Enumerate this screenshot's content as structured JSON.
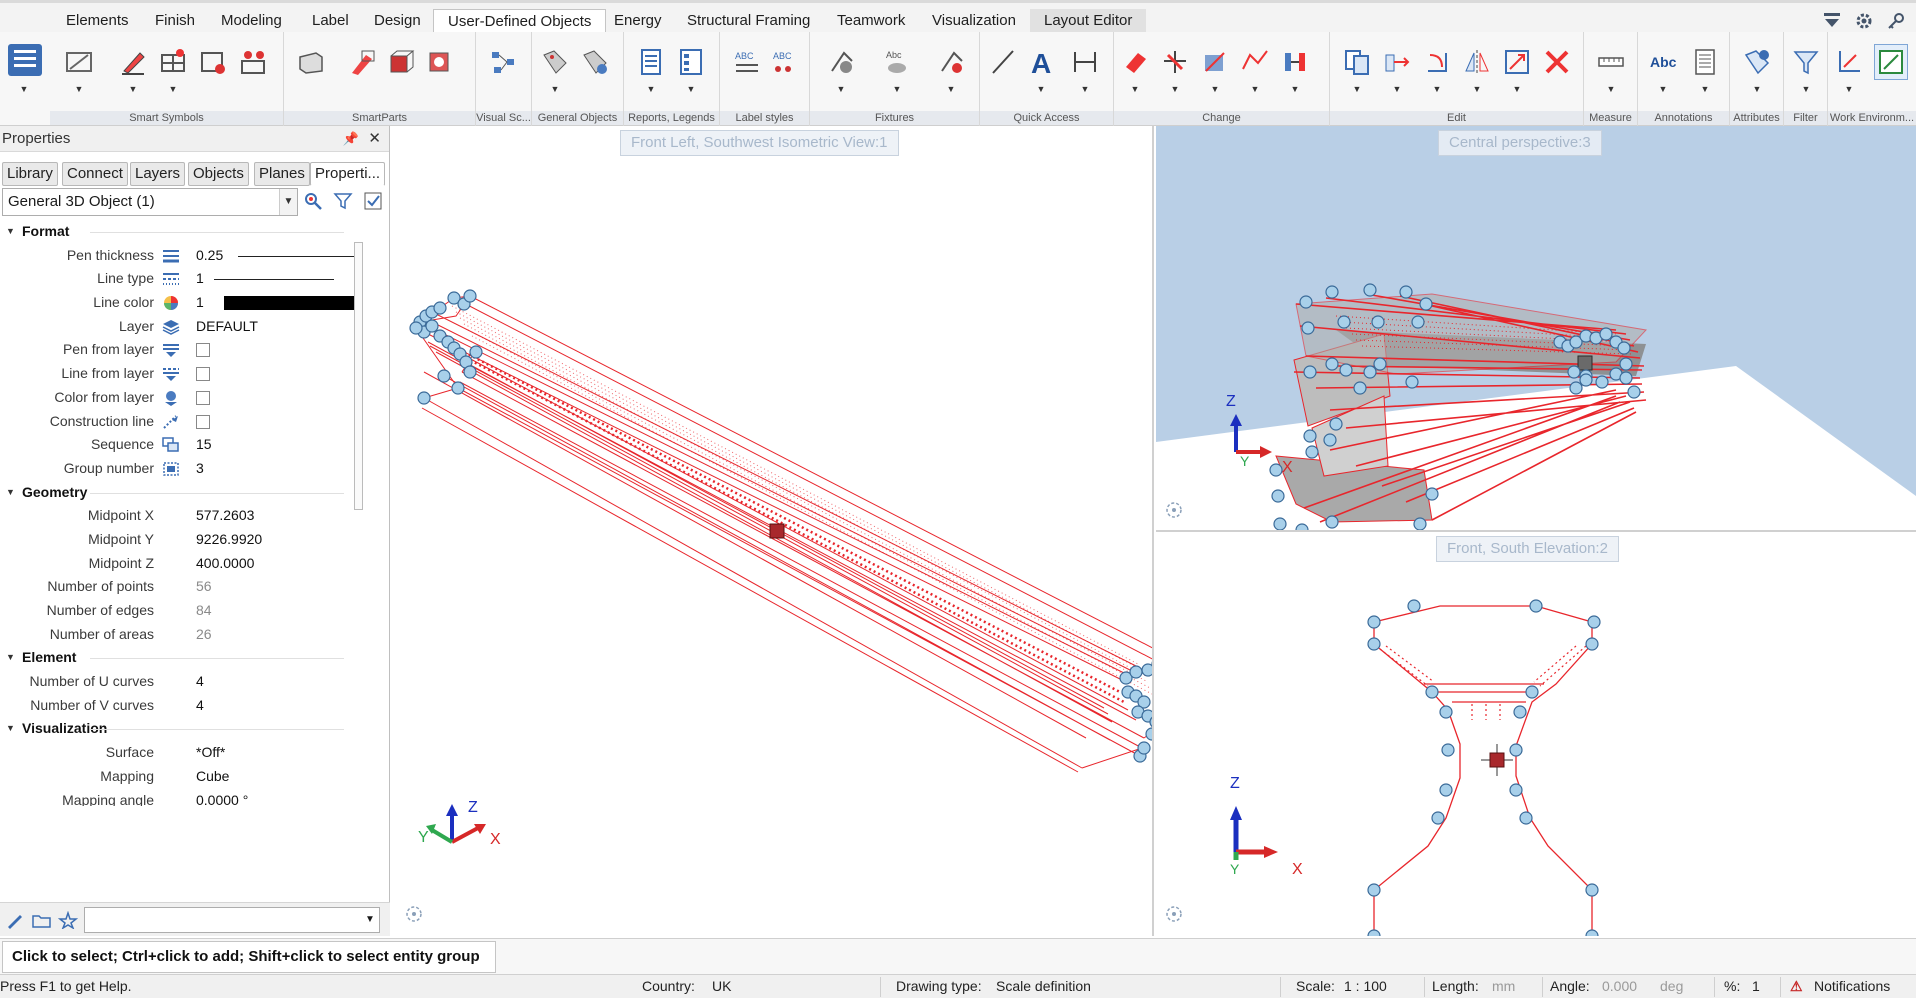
{
  "menu_tabs": [
    "Elements",
    "Finish",
    "Modeling",
    "Label",
    "Design",
    "User-Defined Objects",
    "Energy",
    "Structural Framing",
    "Teamwork",
    "Visualization",
    "Layout Editor"
  ],
  "active_tab": "User-Defined Objects",
  "ribbon_groups": [
    "Smart Symbols",
    "SmartParts",
    "Visual Sc...",
    "General Objects",
    "Reports, Legends",
    "Label styles",
    "Fixtures",
    "Quick Access",
    "Change",
    "Edit",
    "Measure",
    "Annotations",
    "Attributes",
    "Filter",
    "Work Environm..."
  ],
  "properties": {
    "title": "Properties",
    "tabs": [
      "Library",
      "Connect",
      "Layers",
      "Objects",
      "Planes",
      "Properti..."
    ],
    "object_selector": "General 3D Object (1)",
    "sections": {
      "format": "Format",
      "geometry": "Geometry",
      "element": "Element",
      "visualization": "Visualization"
    },
    "format": {
      "pen_thickness_label": "Pen thickness",
      "pen_thickness": "0.25",
      "line_type_label": "Line type",
      "line_type": "1",
      "line_color_label": "Line color",
      "line_color": "1",
      "layer_label": "Layer",
      "layer": "DEFAULT",
      "pen_from_layer_label": "Pen from layer",
      "line_from_layer_label": "Line from layer",
      "color_from_layer_label": "Color from layer",
      "construction_line_label": "Construction line",
      "sequence_label": "Sequence",
      "sequence": "15",
      "group_number_label": "Group number",
      "group_number": "3"
    },
    "geometry": {
      "midpoint_x_label": "Midpoint X",
      "midpoint_x": "577.2603",
      "midpoint_y_label": "Midpoint Y",
      "midpoint_y": "9226.9920",
      "midpoint_z_label": "Midpoint Z",
      "midpoint_z": "400.0000",
      "num_points_label": "Number of points",
      "num_points": "56",
      "num_edges_label": "Number of edges",
      "num_edges": "84",
      "num_areas_label": "Number of areas",
      "num_areas": "26"
    },
    "element": {
      "u_curves_label": "Number of U curves",
      "u_curves": "4",
      "v_curves_label": "Number of V curves",
      "v_curves": "4"
    },
    "visualization": {
      "surface_label": "Surface",
      "surface": "*Off*",
      "mapping_label": "Mapping",
      "mapping": "Cube",
      "mapping_angle_label": "Mapping angle",
      "mapping_angle": "0.0000 °"
    }
  },
  "viewports": {
    "iso_title": "Front Left, Southwest Isometric View:1",
    "persp_title": "Central perspective:3",
    "front_title": "Front, South Elevation:2",
    "axis_x": "X",
    "axis_y": "Y",
    "axis_z": "Z"
  },
  "command_message": "Click to select; Ctrl+click to add; Shift+click to select entity group",
  "status": {
    "help": "Press F1 to get Help.",
    "country_label": "Country:",
    "country": "UK",
    "drawing_type_label": "Drawing type:",
    "drawing_type": "Scale definition",
    "scale_label": "Scale:",
    "scale": "1 : 100",
    "length_label": "Length:",
    "length_unit": "mm",
    "angle_label": "Angle:",
    "angle": "0.000",
    "angle_unit": "deg",
    "percent_label": "%:",
    "percent": "1",
    "notifications": "Notifications"
  },
  "colors": {
    "accent_red": "#e8262c",
    "handle_blue": "#a8d0ea",
    "sky": "#b9cfe6"
  }
}
